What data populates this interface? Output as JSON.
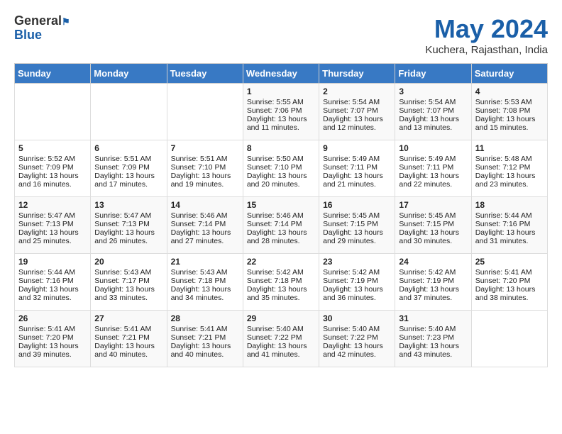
{
  "header": {
    "logo_line1": "General",
    "logo_line2": "Blue",
    "month_title": "May 2024",
    "location": "Kuchera, Rajasthan, India"
  },
  "days_of_week": [
    "Sunday",
    "Monday",
    "Tuesday",
    "Wednesday",
    "Thursday",
    "Friday",
    "Saturday"
  ],
  "weeks": [
    [
      {
        "day": "",
        "data": ""
      },
      {
        "day": "",
        "data": ""
      },
      {
        "day": "",
        "data": ""
      },
      {
        "day": "1",
        "data": "Sunrise: 5:55 AM\nSunset: 7:06 PM\nDaylight: 13 hours\nand 11 minutes."
      },
      {
        "day": "2",
        "data": "Sunrise: 5:54 AM\nSunset: 7:07 PM\nDaylight: 13 hours\nand 12 minutes."
      },
      {
        "day": "3",
        "data": "Sunrise: 5:54 AM\nSunset: 7:07 PM\nDaylight: 13 hours\nand 13 minutes."
      },
      {
        "day": "4",
        "data": "Sunrise: 5:53 AM\nSunset: 7:08 PM\nDaylight: 13 hours\nand 15 minutes."
      }
    ],
    [
      {
        "day": "5",
        "data": "Sunrise: 5:52 AM\nSunset: 7:09 PM\nDaylight: 13 hours\nand 16 minutes."
      },
      {
        "day": "6",
        "data": "Sunrise: 5:51 AM\nSunset: 7:09 PM\nDaylight: 13 hours\nand 17 minutes."
      },
      {
        "day": "7",
        "data": "Sunrise: 5:51 AM\nSunset: 7:10 PM\nDaylight: 13 hours\nand 19 minutes."
      },
      {
        "day": "8",
        "data": "Sunrise: 5:50 AM\nSunset: 7:10 PM\nDaylight: 13 hours\nand 20 minutes."
      },
      {
        "day": "9",
        "data": "Sunrise: 5:49 AM\nSunset: 7:11 PM\nDaylight: 13 hours\nand 21 minutes."
      },
      {
        "day": "10",
        "data": "Sunrise: 5:49 AM\nSunset: 7:11 PM\nDaylight: 13 hours\nand 22 minutes."
      },
      {
        "day": "11",
        "data": "Sunrise: 5:48 AM\nSunset: 7:12 PM\nDaylight: 13 hours\nand 23 minutes."
      }
    ],
    [
      {
        "day": "12",
        "data": "Sunrise: 5:47 AM\nSunset: 7:13 PM\nDaylight: 13 hours\nand 25 minutes."
      },
      {
        "day": "13",
        "data": "Sunrise: 5:47 AM\nSunset: 7:13 PM\nDaylight: 13 hours\nand 26 minutes."
      },
      {
        "day": "14",
        "data": "Sunrise: 5:46 AM\nSunset: 7:14 PM\nDaylight: 13 hours\nand 27 minutes."
      },
      {
        "day": "15",
        "data": "Sunrise: 5:46 AM\nSunset: 7:14 PM\nDaylight: 13 hours\nand 28 minutes."
      },
      {
        "day": "16",
        "data": "Sunrise: 5:45 AM\nSunset: 7:15 PM\nDaylight: 13 hours\nand 29 minutes."
      },
      {
        "day": "17",
        "data": "Sunrise: 5:45 AM\nSunset: 7:15 PM\nDaylight: 13 hours\nand 30 minutes."
      },
      {
        "day": "18",
        "data": "Sunrise: 5:44 AM\nSunset: 7:16 PM\nDaylight: 13 hours\nand 31 minutes."
      }
    ],
    [
      {
        "day": "19",
        "data": "Sunrise: 5:44 AM\nSunset: 7:16 PM\nDaylight: 13 hours\nand 32 minutes."
      },
      {
        "day": "20",
        "data": "Sunrise: 5:43 AM\nSunset: 7:17 PM\nDaylight: 13 hours\nand 33 minutes."
      },
      {
        "day": "21",
        "data": "Sunrise: 5:43 AM\nSunset: 7:18 PM\nDaylight: 13 hours\nand 34 minutes."
      },
      {
        "day": "22",
        "data": "Sunrise: 5:42 AM\nSunset: 7:18 PM\nDaylight: 13 hours\nand 35 minutes."
      },
      {
        "day": "23",
        "data": "Sunrise: 5:42 AM\nSunset: 7:19 PM\nDaylight: 13 hours\nand 36 minutes."
      },
      {
        "day": "24",
        "data": "Sunrise: 5:42 AM\nSunset: 7:19 PM\nDaylight: 13 hours\nand 37 minutes."
      },
      {
        "day": "25",
        "data": "Sunrise: 5:41 AM\nSunset: 7:20 PM\nDaylight: 13 hours\nand 38 minutes."
      }
    ],
    [
      {
        "day": "26",
        "data": "Sunrise: 5:41 AM\nSunset: 7:20 PM\nDaylight: 13 hours\nand 39 minutes."
      },
      {
        "day": "27",
        "data": "Sunrise: 5:41 AM\nSunset: 7:21 PM\nDaylight: 13 hours\nand 40 minutes."
      },
      {
        "day": "28",
        "data": "Sunrise: 5:41 AM\nSunset: 7:21 PM\nDaylight: 13 hours\nand 40 minutes."
      },
      {
        "day": "29",
        "data": "Sunrise: 5:40 AM\nSunset: 7:22 PM\nDaylight: 13 hours\nand 41 minutes."
      },
      {
        "day": "30",
        "data": "Sunrise: 5:40 AM\nSunset: 7:22 PM\nDaylight: 13 hours\nand 42 minutes."
      },
      {
        "day": "31",
        "data": "Sunrise: 5:40 AM\nSunset: 7:23 PM\nDaylight: 13 hours\nand 43 minutes."
      },
      {
        "day": "",
        "data": ""
      }
    ]
  ]
}
